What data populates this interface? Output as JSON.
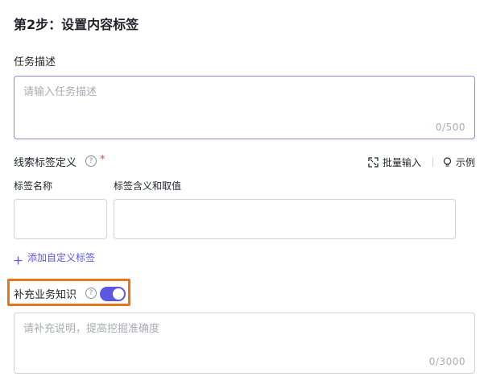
{
  "step_title": "第2步：设置内容标签",
  "task_description": {
    "label": "任务描述",
    "placeholder": "请输入任务描述",
    "counter": "0/500"
  },
  "clue_tags": {
    "label": "线索标签定义",
    "required_mark": "*",
    "batch_input_label": "批量输入",
    "example_label": "示例",
    "col_name": "标签名称",
    "col_meaning": "标签含义和取值",
    "add_custom_label": "添加自定义标签"
  },
  "business_knowledge": {
    "label": "补充业务知识",
    "toggle_on": true,
    "placeholder": "请补充说明，提高挖掘准确度",
    "counter": "0/3000"
  },
  "colors": {
    "accent": "#5b57e0",
    "highlight": "#e8741c",
    "required": "#e5484d"
  },
  "icons": {
    "help": "question-circle-icon",
    "batch": "expand-icon",
    "example": "lightbulb-icon",
    "add": "plus-icon"
  }
}
